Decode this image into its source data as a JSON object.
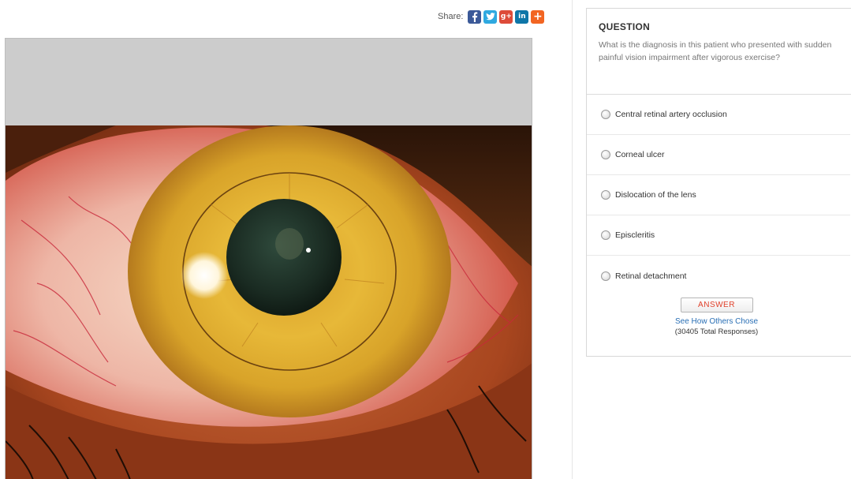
{
  "share": {
    "label": "Share:",
    "buttons": [
      {
        "name": "facebook-icon",
        "color": "#3b5998",
        "glyph": "f"
      },
      {
        "name": "twitter-icon",
        "color": "#2fa9e0",
        "glyph": "t"
      },
      {
        "name": "google-plus-icon",
        "color": "#dd4b39",
        "glyph": "g+"
      },
      {
        "name": "linkedin-icon",
        "color": "#0e76a8",
        "glyph": "in"
      },
      {
        "name": "add-share-icon",
        "color": "#f26522",
        "glyph": "+"
      }
    ]
  },
  "question": {
    "heading": "QUESTION",
    "text": "What is the diagnosis in this patient who presented with sudden painful vision impairment after vigorous exercise?",
    "options": [
      "Central retinal artery occlusion",
      "Corneal ulcer",
      "Dislocation of the lens",
      "Episcleritis",
      "Retinal detachment"
    ],
    "answer_label": "ANSWER",
    "see_others": "See How Others Chose",
    "responses": "(30405 Total Responses)"
  }
}
